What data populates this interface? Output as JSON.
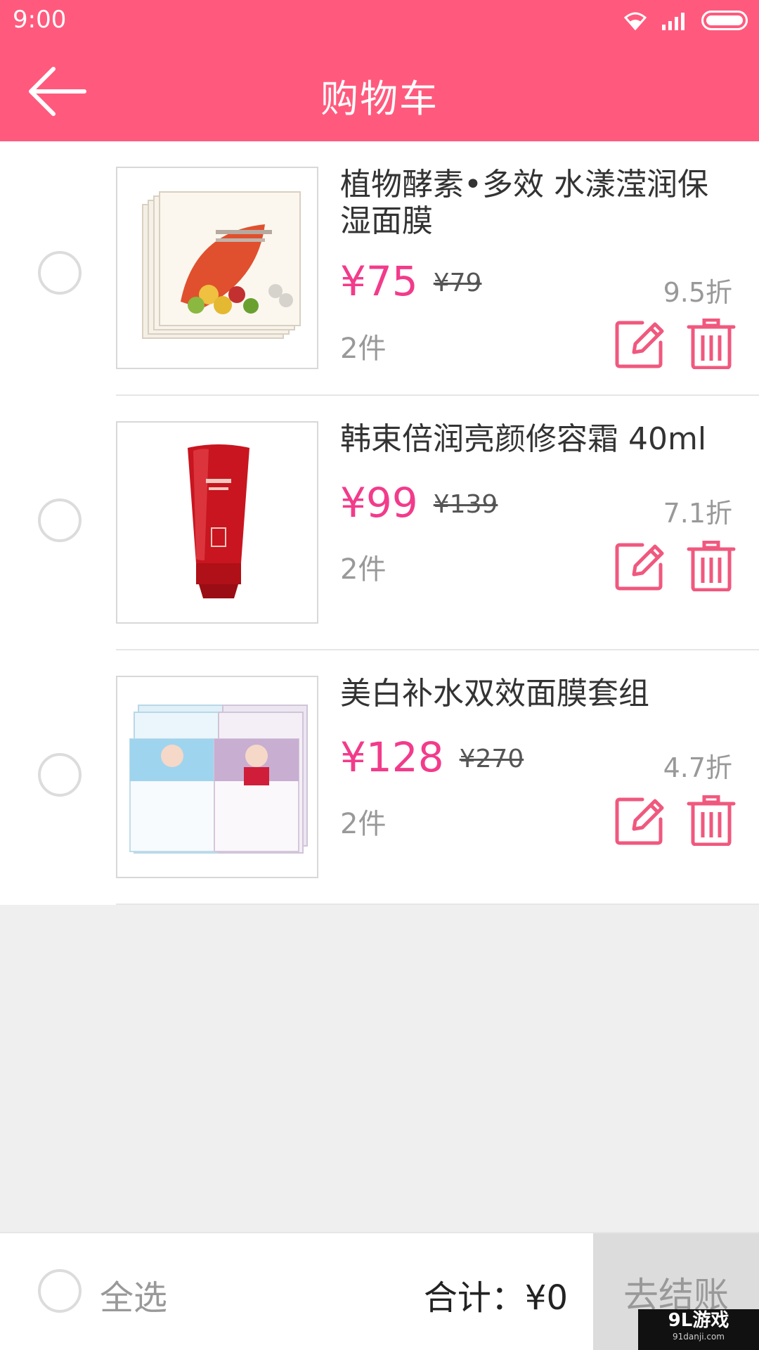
{
  "status_bar": {
    "time": "9:00"
  },
  "app_bar": {
    "title": "购物车"
  },
  "cart": {
    "items": [
      {
        "name": "植物酵素•多效 水漾滢润保湿面膜",
        "price": "¥75",
        "original_price": "¥79",
        "discount": "9.5折",
        "quantity": "2件"
      },
      {
        "name": "韩束倍润亮颜修容霜 40ml",
        "price": "¥99",
        "original_price": "¥139",
        "discount": "7.1折",
        "quantity": "2件"
      },
      {
        "name": "美白补水双效面膜套组",
        "price": "¥128",
        "original_price": "¥270",
        "discount": "4.7折",
        "quantity": "2件"
      }
    ]
  },
  "bottom_bar": {
    "select_all_label": "全选",
    "total_label": "合计：¥0",
    "checkout_label": "去结账"
  },
  "watermark": {
    "main": "9L游戏",
    "sub": "91danji.com"
  },
  "colors": {
    "primary": "#ff5a7d",
    "price": "#f23b8b",
    "icon": "#f0587e"
  }
}
